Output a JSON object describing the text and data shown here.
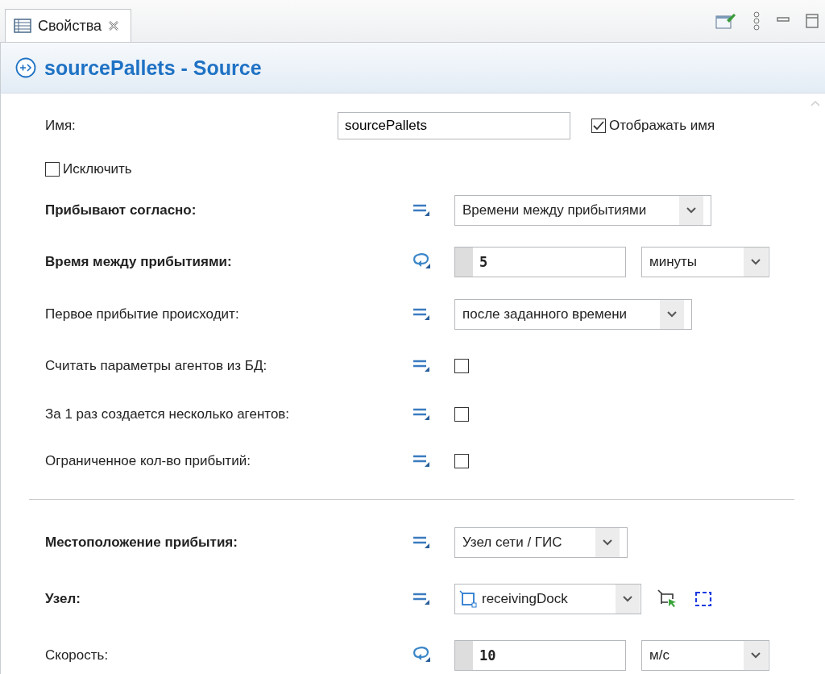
{
  "tab": {
    "label": "Свойства",
    "selected": true
  },
  "header": {
    "title": "sourcePallets - Source"
  },
  "name_row": {
    "label": "Имя:",
    "value": "sourcePallets",
    "show_name": {
      "label": "Отображать имя",
      "checked": true
    }
  },
  "exclude": {
    "label": "Исключить",
    "checked": false
  },
  "rows": [
    {
      "label": "Прибывают согласно:",
      "bold": true,
      "dynamic": false,
      "kind": "dropdown",
      "value": "Времени между прибытиями"
    },
    {
      "label": "Время между прибытиями:",
      "bold": true,
      "dynamic": true,
      "kind": "number_unit",
      "value": "5",
      "unit": "минуты"
    },
    {
      "label": "Первое прибытие происходит:",
      "bold": false,
      "dynamic": false,
      "kind": "dropdown",
      "value": "после заданного времени"
    },
    {
      "label": "Считать параметры агентов из БД:",
      "bold": false,
      "dynamic": false,
      "kind": "checkbox",
      "checked": false
    },
    {
      "label": "За 1 раз создается несколько агентов:",
      "bold": false,
      "dynamic": false,
      "kind": "checkbox",
      "checked": false
    },
    {
      "label": "Ограниченное кол-во прибытий:",
      "bold": false,
      "dynamic": false,
      "kind": "checkbox",
      "checked": false
    },
    {
      "kind": "divider"
    },
    {
      "label": "Местоположение прибытия:",
      "bold": true,
      "dynamic": false,
      "kind": "dropdown",
      "value": "Узел сети / ГИС"
    },
    {
      "label": "Узел:",
      "bold": true,
      "dynamic": false,
      "kind": "node",
      "value": "receivingDock"
    },
    {
      "label": "Скорость:",
      "bold": false,
      "dynamic": true,
      "kind": "number_unit",
      "value": "10",
      "unit": "м/с"
    }
  ]
}
